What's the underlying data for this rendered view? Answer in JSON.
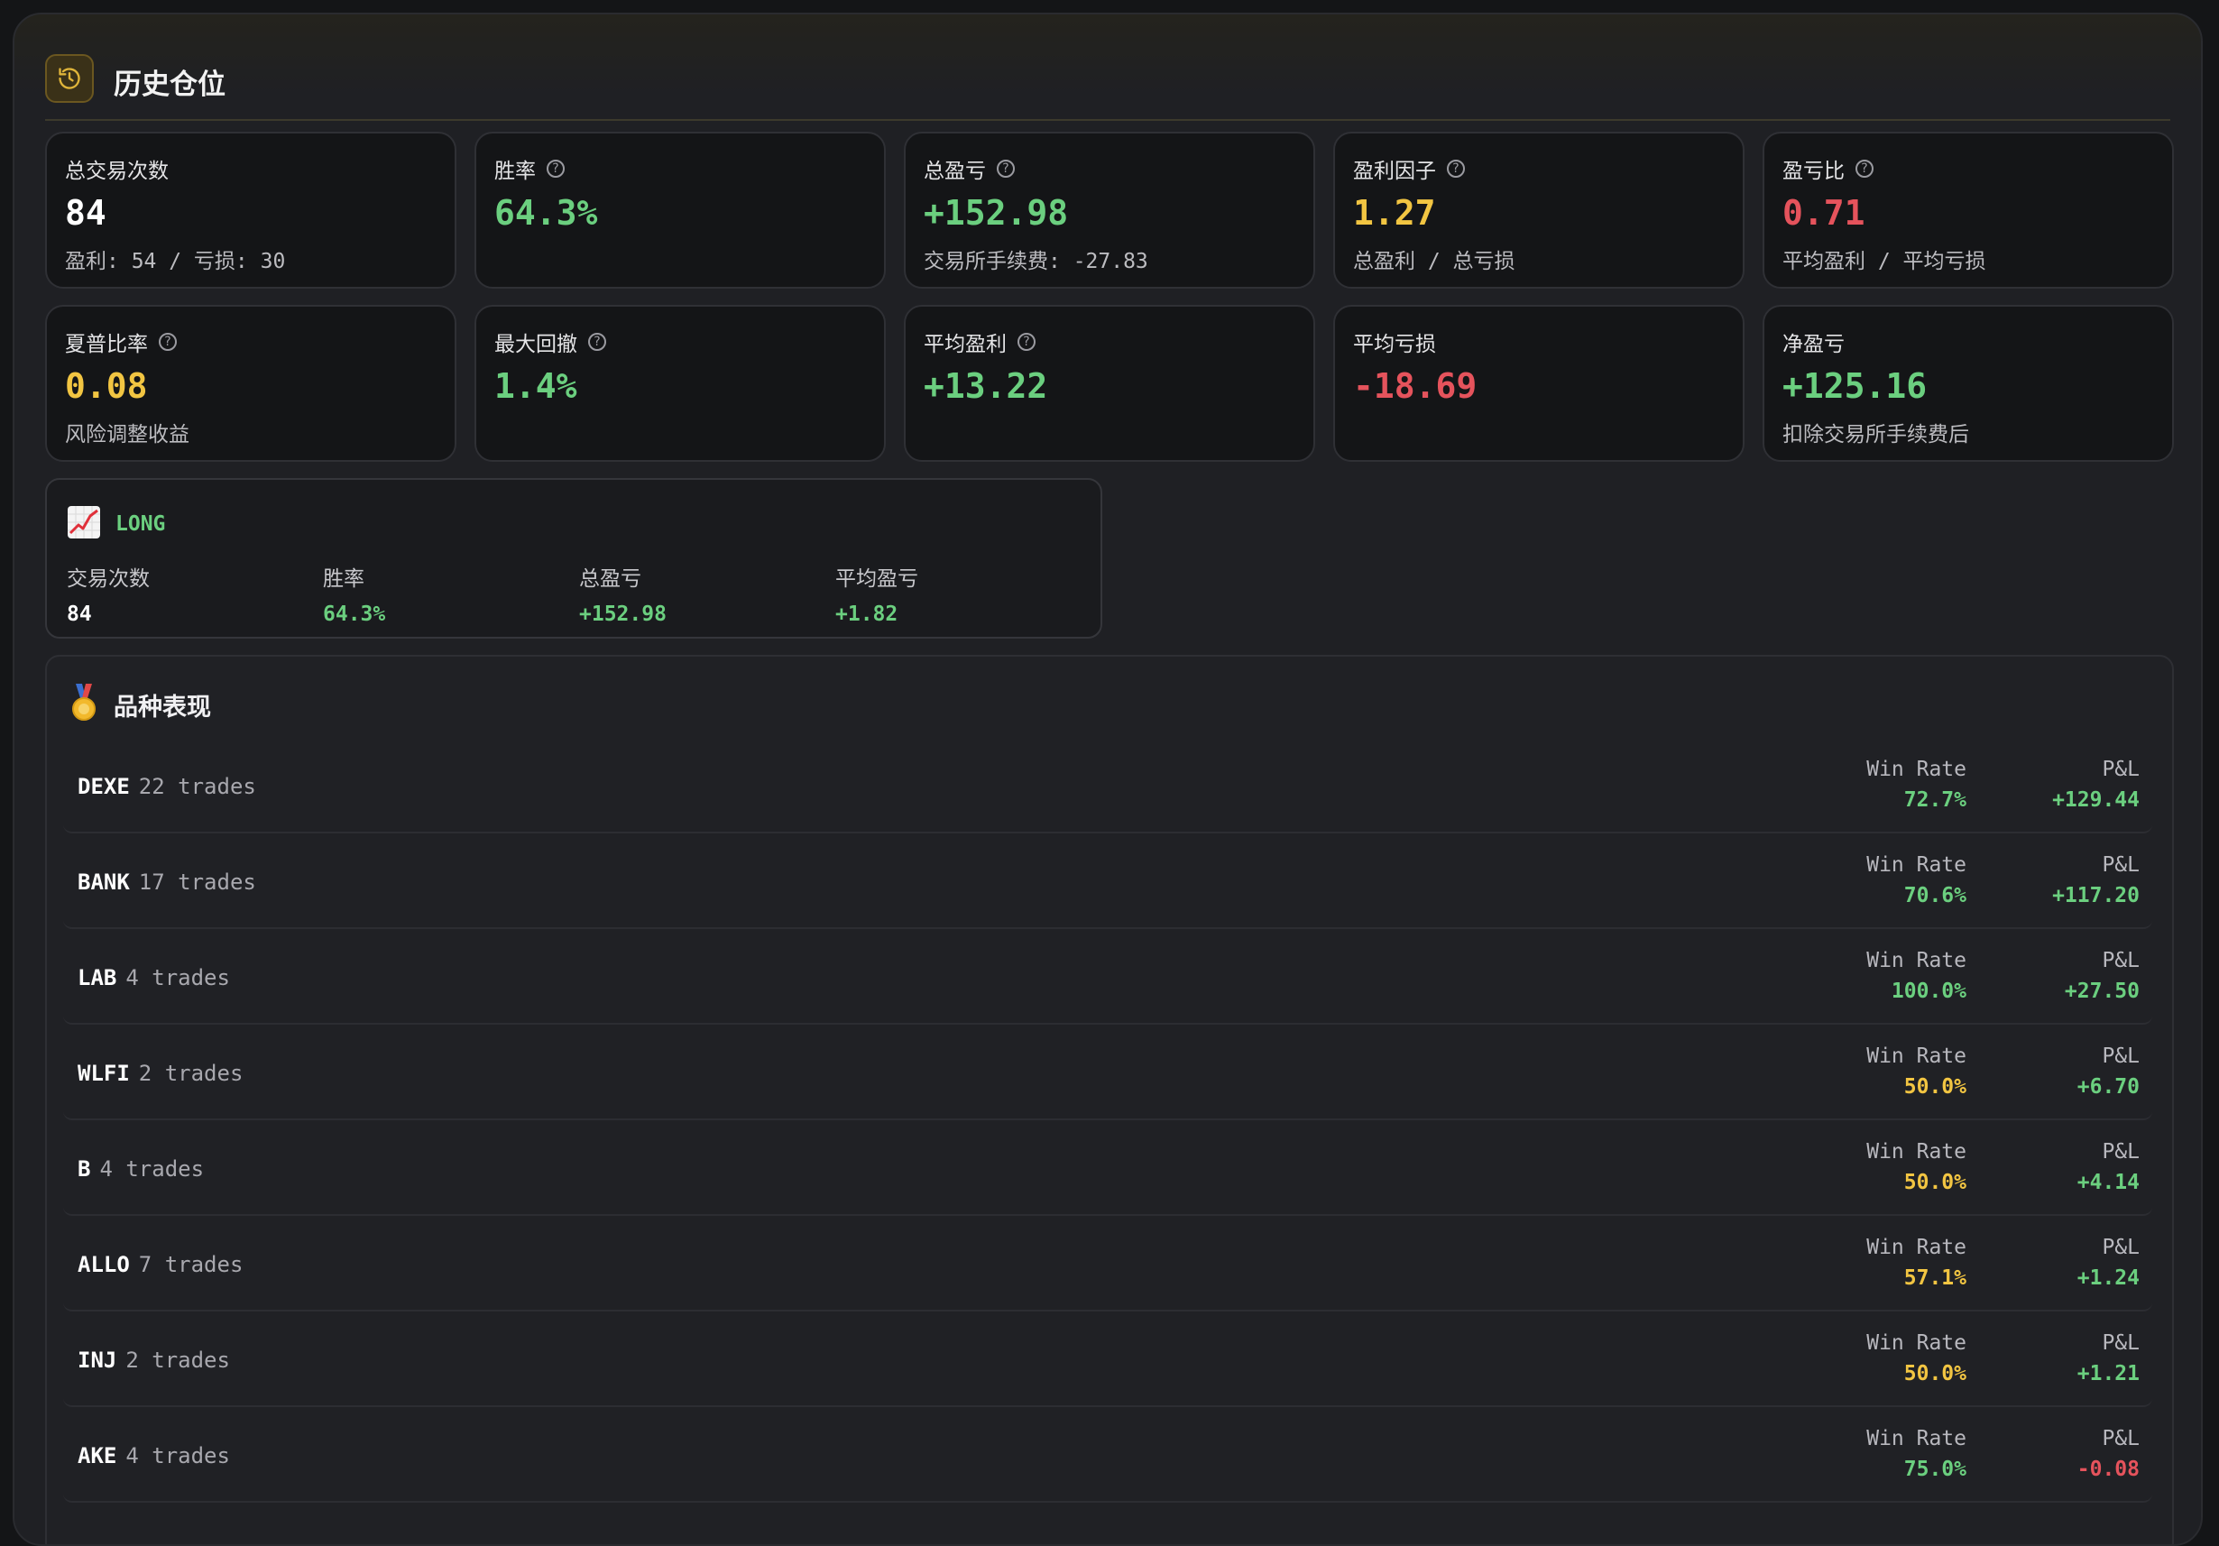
{
  "header": {
    "title": "历史仓位",
    "icon": "history-icon"
  },
  "stats": [
    {
      "label": "总交易次数",
      "help": false,
      "value": "84",
      "color": "#ffffff",
      "sub": "盈利: 54 / 亏损: 30"
    },
    {
      "label": "胜率",
      "help": true,
      "value": "64.3%",
      "color": "#6bcf7f",
      "sub": ""
    },
    {
      "label": "总盈亏",
      "help": true,
      "value": "+152.98",
      "color": "#6bcf7f",
      "sub": "交易所手续费: -27.83"
    },
    {
      "label": "盈利因子",
      "help": true,
      "value": "1.27",
      "color": "#f2c542",
      "sub": "总盈利 / 总亏损"
    },
    {
      "label": "盈亏比",
      "help": true,
      "value": "0.71",
      "color": "#e5535c",
      "sub": "平均盈利 / 平均亏损"
    },
    {
      "label": "夏普比率",
      "help": true,
      "value": "0.08",
      "color": "#f2c542",
      "sub": "风险调整收益"
    },
    {
      "label": "最大回撤",
      "help": true,
      "value": "1.4%",
      "color": "#6bcf7f",
      "sub": ""
    },
    {
      "label": "平均盈利",
      "help": true,
      "value": "+13.22",
      "color": "#6bcf7f",
      "sub": ""
    },
    {
      "label": "平均亏损",
      "help": false,
      "value": "-18.69",
      "color": "#e5535c",
      "sub": ""
    },
    {
      "label": "净盈亏",
      "help": false,
      "value": "+125.16",
      "color": "#6bcf7f",
      "sub": "扣除交易所手续费后"
    }
  ],
  "long": {
    "title": "LONG",
    "icon": "chart-increasing-icon",
    "stats": [
      {
        "label": "交易次数",
        "value": "84",
        "color": "#ffffff"
      },
      {
        "label": "胜率",
        "value": "64.3%",
        "color": "#6bcf7f"
      },
      {
        "label": "总盈亏",
        "value": "+152.98",
        "color": "#6bcf7f"
      },
      {
        "label": "平均盈亏",
        "value": "+1.82",
        "color": "#6bcf7f"
      }
    ]
  },
  "performance": {
    "title": "品种表现",
    "icon": "medal-icon",
    "winrate_label": "Win Rate",
    "pnl_label": "P&L",
    "rows": [
      {
        "symbol": "DEXE",
        "trades": "22 trades",
        "win_rate": "72.7%",
        "win_color": "#6bcf7f",
        "pnl": "+129.44",
        "pnl_color": "#6bcf7f"
      },
      {
        "symbol": "BANK",
        "trades": "17 trades",
        "win_rate": "70.6%",
        "win_color": "#6bcf7f",
        "pnl": "+117.20",
        "pnl_color": "#6bcf7f"
      },
      {
        "symbol": "LAB",
        "trades": "4 trades",
        "win_rate": "100.0%",
        "win_color": "#6bcf7f",
        "pnl": "+27.50",
        "pnl_color": "#6bcf7f"
      },
      {
        "symbol": "WLFI",
        "trades": "2 trades",
        "win_rate": "50.0%",
        "win_color": "#f2c542",
        "pnl": "+6.70",
        "pnl_color": "#6bcf7f"
      },
      {
        "symbol": "B",
        "trades": "4 trades",
        "win_rate": "50.0%",
        "win_color": "#f2c542",
        "pnl": "+4.14",
        "pnl_color": "#6bcf7f"
      },
      {
        "symbol": "ALLO",
        "trades": "7 trades",
        "win_rate": "57.1%",
        "win_color": "#f2c542",
        "pnl": "+1.24",
        "pnl_color": "#6bcf7f"
      },
      {
        "symbol": "INJ",
        "trades": "2 trades",
        "win_rate": "50.0%",
        "win_color": "#f2c542",
        "pnl": "+1.21",
        "pnl_color": "#6bcf7f"
      },
      {
        "symbol": "AKE",
        "trades": "4 trades",
        "win_rate": "75.0%",
        "win_color": "#6bcf7f",
        "pnl": "-0.08",
        "pnl_color": "#e5535c"
      }
    ]
  }
}
